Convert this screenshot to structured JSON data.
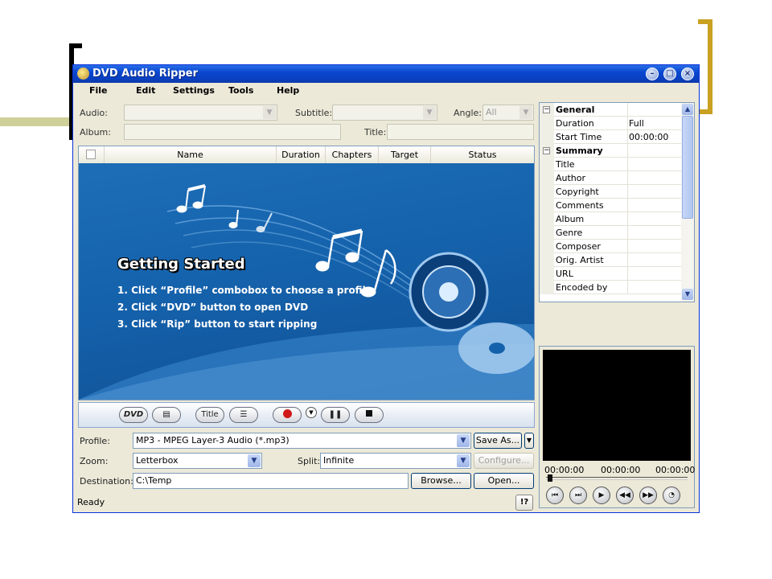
{
  "window": {
    "title": "DVD Audio Ripper"
  },
  "menu": [
    "File",
    "Edit",
    "Settings",
    "Tools",
    "Help"
  ],
  "top_fields": {
    "audio_label": "Audio:",
    "subtitle_label": "Subtitle:",
    "angle_label": "Angle:",
    "angle_value": "All",
    "album_label": "Album:",
    "title_label": "Title:"
  },
  "columns": [
    "Name",
    "Duration",
    "Chapters",
    "Target",
    "Status"
  ],
  "banner": {
    "heading": "Getting Started",
    "steps": [
      "1. Click “Profile” combobox to choose a profile",
      "2. Click “DVD” button to open DVD",
      "3. Click “Rip” button to start ripping"
    ]
  },
  "toolbar": {
    "dvd_label": "DVD",
    "title_label": "Title"
  },
  "settings": {
    "profile_label": "Profile:",
    "profile_value": "MP3 - MPEG Layer-3 Audio (*.mp3)",
    "save_as": "Save As...",
    "zoom_label": "Zoom:",
    "zoom_value": "Letterbox",
    "split_label": "Split:",
    "split_value": "Infinite",
    "configure": "Configure...",
    "destination_label": "Destination:",
    "destination_value": "C:\\Temp",
    "browse": "Browse...",
    "open": "Open..."
  },
  "status": {
    "text": "Ready",
    "help": "!?"
  },
  "properties": {
    "general": "General",
    "general_rows": [
      {
        "key": "Duration",
        "value": "Full"
      },
      {
        "key": "Start Time",
        "value": "00:00:00"
      }
    ],
    "summary": "Summary",
    "summary_rows": [
      "Title",
      "Author",
      "Copyright",
      "Comments",
      "Album",
      "Genre",
      "Composer",
      "Orig. Artist",
      "URL",
      "Encoded by"
    ]
  },
  "player": {
    "time_start": "00:00:00",
    "time_current": "00:00:00",
    "time_end": "00:00:00"
  },
  "colors": {
    "titlebar": "#0a47d0",
    "banner": "#1562ac",
    "bracket_right": "#c9a020"
  }
}
